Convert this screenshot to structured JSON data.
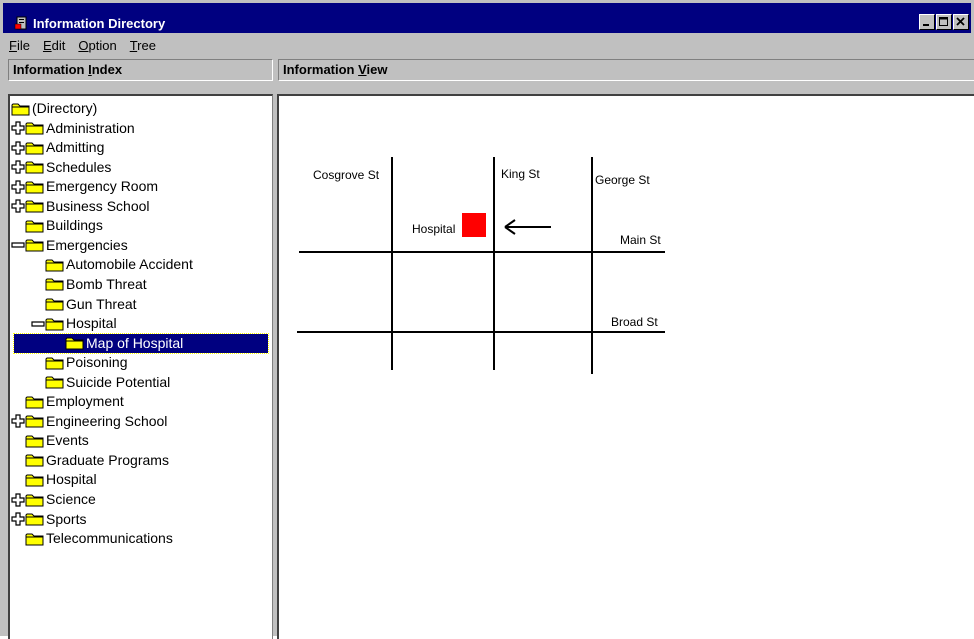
{
  "window": {
    "title": "Information Directory",
    "icon": "directory-app-icon"
  },
  "menu": [
    {
      "pre": "",
      "key": "F",
      "post": "ile"
    },
    {
      "pre": "",
      "key": "E",
      "post": "dit"
    },
    {
      "pre": "",
      "key": "O",
      "post": "ption"
    },
    {
      "pre": "",
      "key": "T",
      "post": "ree"
    }
  ],
  "left_header": {
    "pre": "Information ",
    "key": "I",
    "post": "ndex"
  },
  "right_header": {
    "pre": "Information ",
    "key": "V",
    "post": "iew"
  },
  "tree": [
    {
      "label": "(Directory)",
      "depth": 0,
      "expander": "none"
    },
    {
      "label": "Administration",
      "depth": 0,
      "expander": "plus"
    },
    {
      "label": "Admitting",
      "depth": 0,
      "expander": "plus"
    },
    {
      "label": "Schedules",
      "depth": 0,
      "expander": "plus"
    },
    {
      "label": "Emergency Room",
      "depth": 0,
      "expander": "plus"
    },
    {
      "label": "Business School",
      "depth": 0,
      "expander": "plus"
    },
    {
      "label": "Buildings",
      "depth": 0,
      "expander": "leaf"
    },
    {
      "label": "Emergencies",
      "depth": 0,
      "expander": "minus"
    },
    {
      "label": "Automobile Accident",
      "depth": 1,
      "expander": "leaf"
    },
    {
      "label": "Bomb Threat",
      "depth": 1,
      "expander": "leaf"
    },
    {
      "label": "Gun Threat",
      "depth": 1,
      "expander": "leaf"
    },
    {
      "label": "Hospital",
      "depth": 1,
      "expander": "minus"
    },
    {
      "label": "Map of Hospital",
      "depth": 2,
      "expander": "leaf",
      "selected": true
    },
    {
      "label": "Poisoning",
      "depth": 1,
      "expander": "leaf"
    },
    {
      "label": "Suicide Potential",
      "depth": 1,
      "expander": "leaf"
    },
    {
      "label": "Employment",
      "depth": 0,
      "expander": "leaf"
    },
    {
      "label": "Engineering School",
      "depth": 0,
      "expander": "plus"
    },
    {
      "label": "Events",
      "depth": 0,
      "expander": "leaf"
    },
    {
      "label": "Graduate Programs",
      "depth": 0,
      "expander": "leaf"
    },
    {
      "label": "Hospital",
      "depth": 0,
      "expander": "leaf"
    },
    {
      "label": "Science",
      "depth": 0,
      "expander": "plus"
    },
    {
      "label": "Sports",
      "depth": 0,
      "expander": "plus"
    },
    {
      "label": "Telecommunications",
      "depth": 0,
      "expander": "leaf"
    }
  ],
  "map": {
    "streets": {
      "cosgrove": "Cosgrove St",
      "king": "King St",
      "george": "George St",
      "main": "Main St",
      "broad": "Broad St"
    },
    "hospital_label": "Hospital",
    "hospital_color": "#ff0000"
  },
  "colors": {
    "titlebar": "#000080",
    "selection": "#000080",
    "chrome": "#c0c0c0",
    "folder": "#ffff00"
  }
}
